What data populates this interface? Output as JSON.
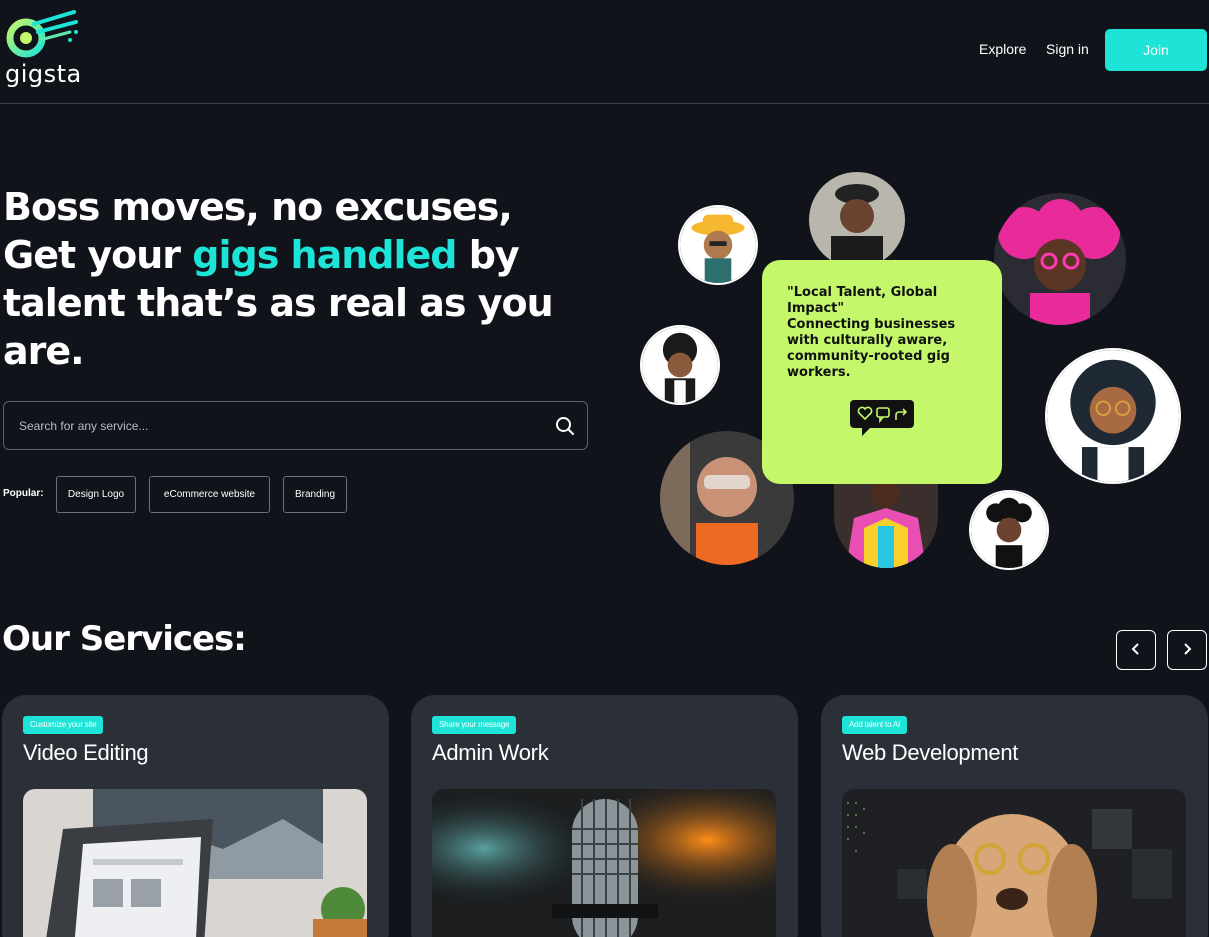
{
  "brand": {
    "name": "gigsta",
    "logo_icon": "gigsta-logo-icon",
    "colors": {
      "accent": "#1de4d6",
      "card": "#c4f76a",
      "background": "#10131a"
    }
  },
  "nav": {
    "explore": "Explore",
    "sign_in": "Sign in",
    "join": "Join"
  },
  "hero": {
    "line1": "Boss moves, no excuses,",
    "line2_pre": "Get your ",
    "line2_accent": "gigs handled",
    "line2_post": " by",
    "line3": "talent that’s as real as you",
    "line4": "are."
  },
  "search": {
    "placeholder": "Search for any service...",
    "icon": "search-icon"
  },
  "popular": {
    "label": "Popular:",
    "items": [
      "Design Logo",
      "eCommerce website",
      "Branding"
    ]
  },
  "quote_card": {
    "text": "\"Local Talent, Global Impact\"\nConnecting businesses with culturally aware, community-rooted gig workers.",
    "icons": [
      "heart-icon",
      "chat-icon",
      "share-icon"
    ]
  },
  "services": {
    "title": "Our Services:",
    "prev_icon": "chevron-left-icon",
    "next_icon": "chevron-right-icon",
    "cards": [
      {
        "tag": "Customize your site",
        "name": "Video Editing",
        "image": "laptop-workspace-photo"
      },
      {
        "tag": "Share your message",
        "name": "Admin Work",
        "image": "microphone-photo"
      },
      {
        "tag": "Add talent to AI",
        "name": "Web Development",
        "image": "dog-with-glasses-photo"
      }
    ]
  }
}
